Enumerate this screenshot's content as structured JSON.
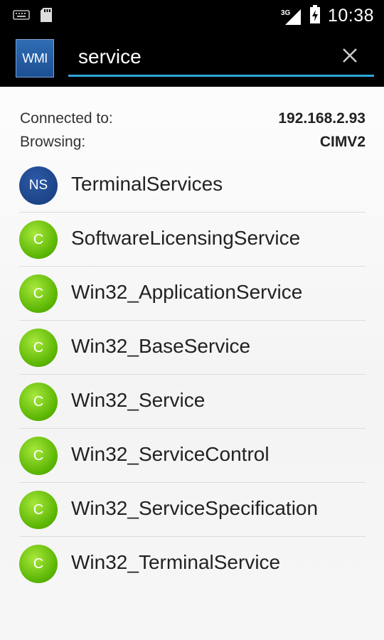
{
  "status_bar": {
    "time": "10:38",
    "network": "3G",
    "icons": [
      "keyboard-icon",
      "sd-card-icon",
      "signal-icon",
      "battery-charging-icon"
    ]
  },
  "action_bar": {
    "logo_text": "WMI",
    "search_value": "service",
    "clear_icon": "close-icon"
  },
  "connection": {
    "connected_label": "Connected to:",
    "connected_value": "192.168.2.93",
    "browsing_label": "Browsing:",
    "browsing_value": "CIMV2"
  },
  "results": [
    {
      "badge": "NS",
      "type": "namespace",
      "name": "TerminalServices"
    },
    {
      "badge": "C",
      "type": "class",
      "name": "SoftwareLicensingService"
    },
    {
      "badge": "C",
      "type": "class",
      "name": "Win32_ApplicationService"
    },
    {
      "badge": "C",
      "type": "class",
      "name": "Win32_BaseService"
    },
    {
      "badge": "C",
      "type": "class",
      "name": "Win32_Service"
    },
    {
      "badge": "C",
      "type": "class",
      "name": "Win32_ServiceControl"
    },
    {
      "badge": "C",
      "type": "class",
      "name": "Win32_ServiceSpecification"
    },
    {
      "badge": "C",
      "type": "class",
      "name": "Win32_TerminalService"
    }
  ],
  "colors": {
    "namespace_badge": "#1d4a92",
    "class_badge": "#6cc410",
    "search_underline": "#2ea7d8"
  }
}
